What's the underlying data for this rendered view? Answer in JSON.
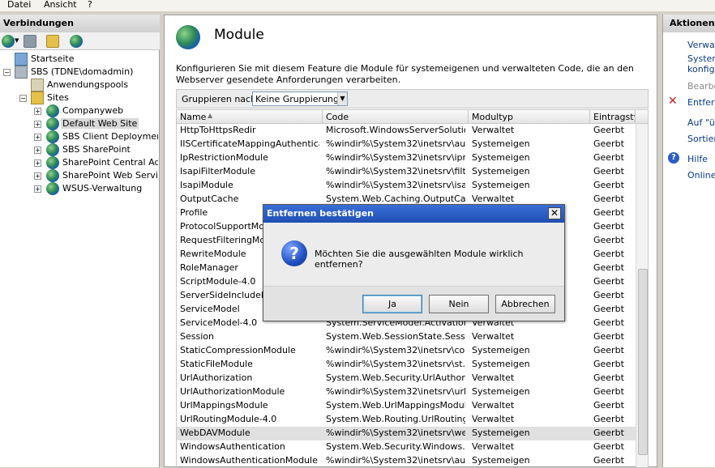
{
  "menu": [
    "Datei",
    "Ansicht",
    "?"
  ],
  "left": {
    "header": "Verbindungen",
    "tree": {
      "startseite": "Startseite",
      "server": "SBS (TDNE\\domadmin)",
      "apppools": "Anwendungspools",
      "sites": "Sites",
      "site_items": [
        "Companyweb",
        "Default Web Site",
        "SBS Client Deployment A",
        "SBS SharePoint",
        "SharePoint Central Admin",
        "SharePoint Web Services",
        "WSUS-Verwaltung"
      ]
    }
  },
  "center": {
    "title": "Module",
    "description": "Konfigurieren Sie mit diesem Feature die Module für systemeigenen und verwalteten Code, die an den Webserver gesendete Anforderungen verarbeiten.",
    "group_label": "Gruppieren nach:",
    "group_value": "Keine Gruppierung",
    "columns": [
      "Name",
      "Code",
      "Modultyp",
      "Eintragstyp"
    ],
    "rows": [
      [
        "HttpToHttpsRedir",
        "Microsoft.WindowsServerSolutio...",
        "Verwaltet",
        "Geerbt"
      ],
      [
        "IISCertificateMappingAuthenticat...",
        "%windir%\\System32\\inetsrv\\au...",
        "Systemeigen",
        "Geerbt"
      ],
      [
        "IpRestrictionModule",
        "%windir%\\System32\\inetsrv\\ipr...",
        "Systemeigen",
        "Geerbt"
      ],
      [
        "IsapiFilterModule",
        "%windir%\\System32\\inetsrv\\filt...",
        "Systemeigen",
        "Geerbt"
      ],
      [
        "IsapiModule",
        "%windir%\\System32\\inetsrv\\isa...",
        "Systemeigen",
        "Geerbt"
      ],
      [
        "OutputCache",
        "System.Web.Caching.OutputCac...",
        "Verwaltet",
        "Geerbt"
      ],
      [
        "Profile",
        "",
        "",
        "Geerbt"
      ],
      [
        "ProtocolSupportModule",
        "",
        "",
        "Geerbt"
      ],
      [
        "RequestFilteringModule",
        "",
        "",
        "Geerbt"
      ],
      [
        "RewriteModule",
        "",
        "",
        "Geerbt"
      ],
      [
        "RoleManager",
        "",
        "",
        "Geerbt"
      ],
      [
        "ScriptModule-4.0",
        "",
        "",
        "Geerbt"
      ],
      [
        "ServerSideIncludeModule",
        "",
        "",
        "Geerbt"
      ],
      [
        "ServiceModel",
        "",
        "",
        "Geerbt"
      ],
      [
        "ServiceModel-4.0",
        "System.ServiceModel.Activation...",
        "Verwaltet",
        "Geerbt"
      ],
      [
        "Session",
        "System.Web.SessionState.Sessi...",
        "Verwaltet",
        "Geerbt"
      ],
      [
        "StaticCompressionModule",
        "%windir%\\System32\\inetsrv\\co...",
        "Systemeigen",
        "Geerbt"
      ],
      [
        "StaticFileModule",
        "%windir%\\System32\\inetsrv\\st...",
        "Systemeigen",
        "Geerbt"
      ],
      [
        "UrlAuthorization",
        "System.Web.Security.UrlAuthori...",
        "Verwaltet",
        "Geerbt"
      ],
      [
        "UrlAuthorizationModule",
        "%windir%\\System32\\inetsrv\\url...",
        "Systemeigen",
        "Geerbt"
      ],
      [
        "UrlMappingsModule",
        "System.Web.UrlMappingsModule",
        "Verwaltet",
        "Geerbt"
      ],
      [
        "UrlRoutingModule-4.0",
        "System.Web.Routing.UrlRouting...",
        "Verwaltet",
        "Geerbt"
      ],
      [
        "WebDAVModule",
        "%windir%\\System32\\inetsrv\\we...",
        "Systemeigen",
        "Geerbt"
      ],
      [
        "WindowsAuthentication",
        "System.Web.Security.Windows...",
        "Verwaltet",
        "Geerbt"
      ],
      [
        "WindowsAuthenticationModule",
        "%windir%\\System32\\inetsrv\\au...",
        "Systemeigen",
        "Geerbt"
      ]
    ],
    "selected_row": "WebDAVModule"
  },
  "right": {
    "header": "Aktionen",
    "actions": {
      "verwalt": "Verwalt",
      "system1": "System",
      "konfigu": "konfigu",
      "bearbe": "Bearbe",
      "entfern": "Entfern",
      "auf_ueb": "Auf \"üb",
      "sortier": "Sortier",
      "hilfe": "Hilfe",
      "onlineh": "Onlineh"
    }
  },
  "dialog": {
    "title": "Entfernen bestätigen",
    "message": "Möchten Sie die ausgewählten Module wirklich entfernen?",
    "yes": "Ja",
    "no": "Nein",
    "cancel": "Abbrechen",
    "close_glyph": "✕",
    "icon_glyph": "?"
  }
}
